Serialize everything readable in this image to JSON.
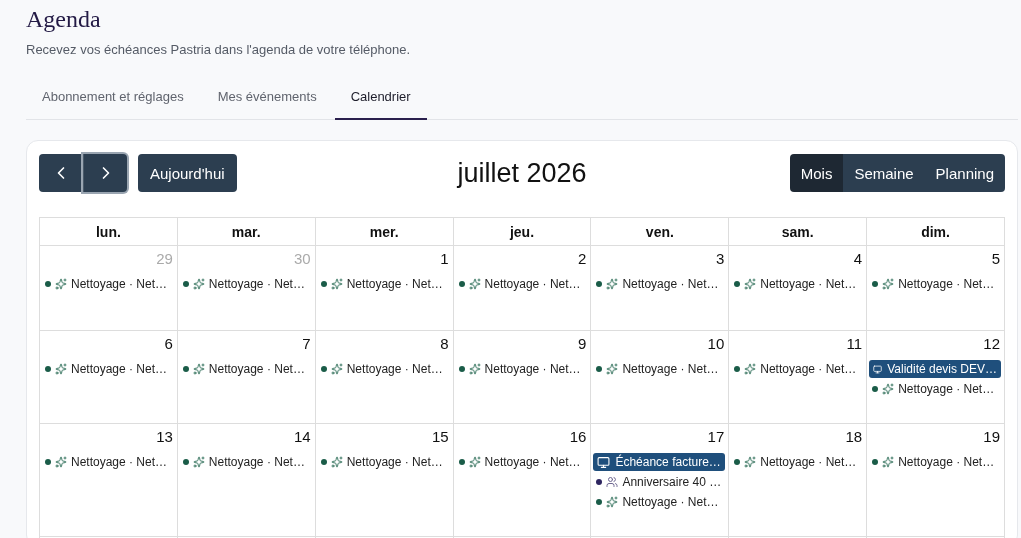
{
  "page": {
    "title": "Agenda",
    "subtitle": "Recevez vos échéances Pastria dans l'agenda de votre téléphone."
  },
  "tabs": [
    {
      "label": "Abonnement et réglages",
      "selected": false
    },
    {
      "label": "Mes événements",
      "selected": false
    },
    {
      "label": "Calendrier",
      "selected": true
    }
  ],
  "toolbar": {
    "nav": [
      {
        "kind": "previous",
        "focused": false
      },
      {
        "kind": "next",
        "focused": true
      }
    ],
    "today": "Aujourd'hui",
    "month_title": "juillet 2026",
    "views": [
      {
        "label": "Mois",
        "selected": true
      },
      {
        "label": "Semaine",
        "selected": false
      },
      {
        "label": "Planning",
        "selected": false
      }
    ]
  },
  "weekdays": [
    "lun.",
    "mar.",
    "mer.",
    "jeu.",
    "ven.",
    "sam.",
    "dim."
  ],
  "weeks": [
    {
      "days": [
        {
          "number": "29",
          "muted": true,
          "events": [
            {
              "kind": "cleaning",
              "color": "#1a5c48",
              "text": "Nettoyage · Net…"
            }
          ]
        },
        {
          "number": "30",
          "muted": true,
          "events": [
            {
              "kind": "cleaning",
              "color": "#1a5c48",
              "text": "Nettoyage · Net…"
            }
          ]
        },
        {
          "number": "1",
          "muted": false,
          "events": [
            {
              "kind": "cleaning",
              "color": "#1a5c48",
              "text": "Nettoyage · Net…"
            }
          ]
        },
        {
          "number": "2",
          "muted": false,
          "events": [
            {
              "kind": "cleaning",
              "color": "#1a5c48",
              "text": "Nettoyage · Net…"
            }
          ]
        },
        {
          "number": "3",
          "muted": false,
          "events": [
            {
              "kind": "cleaning",
              "color": "#1a5c48",
              "text": "Nettoyage · Net…"
            }
          ]
        },
        {
          "number": "4",
          "muted": false,
          "events": [
            {
              "kind": "cleaning",
              "color": "#1a5c48",
              "text": "Nettoyage · Net…"
            }
          ]
        },
        {
          "number": "5",
          "muted": false,
          "events": [
            {
              "kind": "cleaning",
              "color": "#1a5c48",
              "text": "Nettoyage · Net…"
            }
          ]
        }
      ]
    },
    {
      "days": [
        {
          "number": "6",
          "muted": false,
          "events": [
            {
              "kind": "cleaning",
              "color": "#1a5c48",
              "text": "Nettoyage · Net…"
            }
          ]
        },
        {
          "number": "7",
          "muted": false,
          "events": [
            {
              "kind": "cleaning",
              "color": "#1a5c48",
              "text": "Nettoyage · Net…"
            }
          ]
        },
        {
          "number": "8",
          "muted": false,
          "events": [
            {
              "kind": "cleaning",
              "color": "#1a5c48",
              "text": "Nettoyage · Net…"
            }
          ]
        },
        {
          "number": "9",
          "muted": false,
          "events": [
            {
              "kind": "cleaning",
              "color": "#1a5c48",
              "text": "Nettoyage · Net…"
            }
          ]
        },
        {
          "number": "10",
          "muted": false,
          "events": [
            {
              "kind": "cleaning",
              "color": "#1a5c48",
              "text": "Nettoyage · Net…"
            }
          ]
        },
        {
          "number": "11",
          "muted": false,
          "events": [
            {
              "kind": "cleaning",
              "color": "#1a5c48",
              "text": "Nettoyage · Net…"
            }
          ]
        },
        {
          "number": "12",
          "muted": false,
          "events": [
            {
              "kind": "deadline",
              "text": "Validité devis DEV…"
            },
            {
              "kind": "cleaning",
              "color": "#1a5c48",
              "text": "Nettoyage · Net…"
            }
          ]
        }
      ]
    },
    {
      "days": [
        {
          "number": "13",
          "muted": false,
          "events": [
            {
              "kind": "cleaning",
              "color": "#1a5c48",
              "text": "Nettoyage · Net…"
            }
          ]
        },
        {
          "number": "14",
          "muted": false,
          "events": [
            {
              "kind": "cleaning",
              "color": "#1a5c48",
              "text": "Nettoyage · Net…"
            }
          ]
        },
        {
          "number": "15",
          "muted": false,
          "events": [
            {
              "kind": "cleaning",
              "color": "#1a5c48",
              "text": "Nettoyage · Net…"
            }
          ]
        },
        {
          "number": "16",
          "muted": false,
          "events": [
            {
              "kind": "cleaning",
              "color": "#1a5c48",
              "text": "Nettoyage · Net…"
            }
          ]
        },
        {
          "number": "17",
          "muted": false,
          "events": [
            {
              "kind": "deadline",
              "text": "Échéance facture…"
            },
            {
              "kind": "birthday",
              "color": "#2e2660",
              "text": "Anniversaire 40 …"
            },
            {
              "kind": "cleaning",
              "color": "#1a5c48",
              "text": "Nettoyage · Net…"
            }
          ]
        },
        {
          "number": "18",
          "muted": false,
          "events": [
            {
              "kind": "cleaning",
              "color": "#1a5c48",
              "text": "Nettoyage · Net…"
            }
          ]
        },
        {
          "number": "19",
          "muted": false,
          "events": [
            {
              "kind": "cleaning",
              "color": "#1a5c48",
              "text": "Nettoyage · Net…"
            }
          ]
        }
      ]
    }
  ]
}
